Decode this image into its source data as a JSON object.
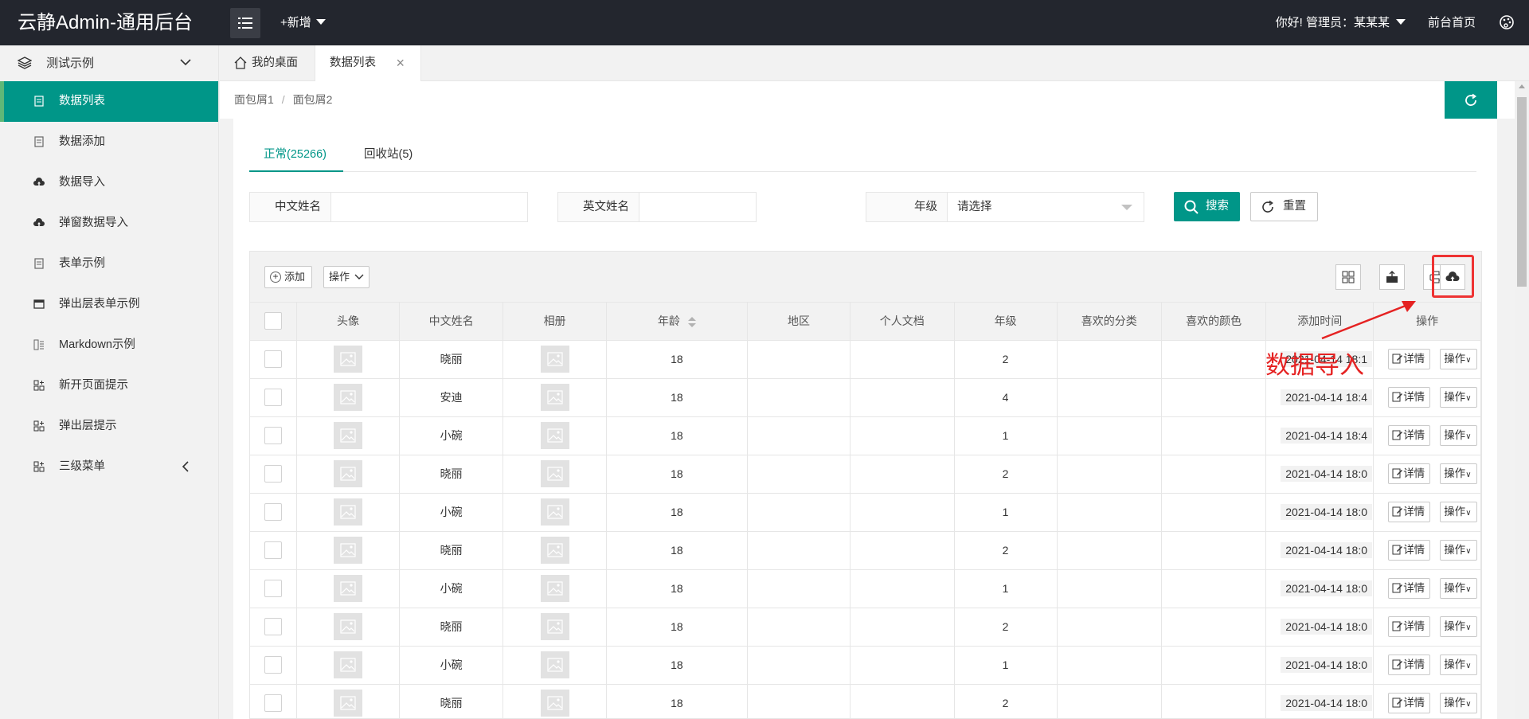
{
  "header": {
    "logo": "云静Admin-通用后台",
    "add_new": "+新增",
    "greeting": "你好!  管理员：某某某",
    "front_home": "前台首页"
  },
  "sidebar": {
    "group_label": "测试示例",
    "items": [
      {
        "label": "数据列表",
        "icon": "file-icon",
        "active": true
      },
      {
        "label": "数据添加",
        "icon": "form-icon"
      },
      {
        "label": "数据导入",
        "icon": "cloud-upload-icon"
      },
      {
        "label": "弹窗数据导入",
        "icon": "cloud-upload-icon"
      },
      {
        "label": "表单示例",
        "icon": "form-icon"
      },
      {
        "label": "弹出层表单示例",
        "icon": "window-icon"
      },
      {
        "label": "Markdown示例",
        "icon": "markdown-icon"
      },
      {
        "label": "新开页面提示",
        "icon": "apps-icon"
      },
      {
        "label": "弹出层提示",
        "icon": "apps-icon"
      },
      {
        "label": "三级菜单",
        "icon": "apps-icon"
      }
    ]
  },
  "tabs": {
    "home": "我的桌面",
    "active": "数据列表"
  },
  "breadcrumb": {
    "first": "面包屑1",
    "separator": "/",
    "second": "面包屑2"
  },
  "content_tabs": {
    "normal": "正常(25266)",
    "recycle": "回收站(5)"
  },
  "filters": {
    "cn_name_label": "中文姓名",
    "cn_name_value": "",
    "en_name_label": "英文姓名",
    "en_name_value": "",
    "grade_label": "年级",
    "grade_selected": "请选择",
    "search_label": "搜索",
    "reset_label": "重置"
  },
  "toolbar": {
    "add_label": "添加",
    "op_label": "操作"
  },
  "table": {
    "headers": [
      "头像",
      "中文姓名",
      "相册",
      "年龄",
      "地区",
      "个人文档",
      "年级",
      "喜欢的分类",
      "喜欢的颜色",
      "添加时间",
      "操作"
    ],
    "rows": [
      {
        "name": "晓丽",
        "age": "18",
        "grade": "2",
        "time": "2021-04-14 18:1"
      },
      {
        "name": "安迪",
        "age": "18",
        "grade": "4",
        "time": "2021-04-14 18:4"
      },
      {
        "name": "小碗",
        "age": "18",
        "grade": "1",
        "time": "2021-04-14 18:4"
      },
      {
        "name": "晓丽",
        "age": "18",
        "grade": "2",
        "time": "2021-04-14 18:0"
      },
      {
        "name": "小碗",
        "age": "18",
        "grade": "1",
        "time": "2021-04-14 18:0"
      },
      {
        "name": "晓丽",
        "age": "18",
        "grade": "2",
        "time": "2021-04-14 18:0"
      },
      {
        "name": "小碗",
        "age": "18",
        "grade": "1",
        "time": "2021-04-14 18:0"
      },
      {
        "name": "晓丽",
        "age": "18",
        "grade": "2",
        "time": "2021-04-14 18:0"
      },
      {
        "name": "小碗",
        "age": "18",
        "grade": "1",
        "time": "2021-04-14 18:0"
      },
      {
        "name": "晓丽",
        "age": "18",
        "grade": "2",
        "time": "2021-04-14 18:0"
      }
    ],
    "detail_label": "详情",
    "op_label": "操作"
  },
  "annotation": {
    "text": "数据导入",
    "color": "#e52222"
  },
  "colors": {
    "accent": "#009688",
    "topbar": "#23262e"
  }
}
